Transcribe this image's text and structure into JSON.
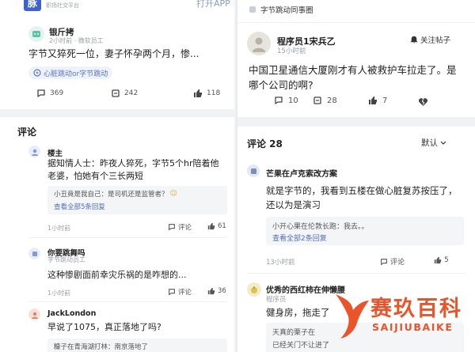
{
  "left": {
    "header": {
      "logo_text": "脉",
      "subtitle": "职场社交平台",
      "open_app": "打开APP"
    },
    "post": {
      "author": "银斤拷",
      "time": "2小时前 · 微软员工",
      "content": "字节又猝死一位，妻子怀孕两个月，惨...",
      "tag": "心脏跳动or字节跳动",
      "stats": {
        "comments": "369",
        "shares": "242",
        "likes": "118"
      }
    },
    "comments_title": "评论",
    "comments": [
      {
        "author": "楼主",
        "content": "据知情人士：昨夜人猝死，字节5个hr陪着他老婆，怕她有个三长两短",
        "quote_line": "小丑竟是我自己：是司机还是监管者？",
        "view_all": "查看全部5条回复",
        "time": "1小时前",
        "comment_label": "评论",
        "likes": "61"
      },
      {
        "author": "你要跳舞吗",
        "role": "字节跳动员工",
        "content": "这种惨剧面前幸灾乐祸的是咋想的...",
        "time": "1小时前",
        "comment_label": "评论",
        "likes": "36"
      },
      {
        "author": "JackLondon",
        "content": "早说了1075，真正落地了吗?",
        "quote_line": "糠子在青海湖打林：南京落地了"
      }
    ]
  },
  "right": {
    "top_tag": "字节跳动同事圈",
    "post": {
      "author": "程序员1宋兵乙",
      "time": "15小时前",
      "follow": "关注帖子",
      "content": "中国卫星通信大厦刚才有人被救护车拉走了。是哪个公司的啊?",
      "stats": {
        "comments": "10",
        "shares": "28",
        "likes": "7"
      }
    },
    "comments_title": "评论 28",
    "sort_label": "默认",
    "comments": [
      {
        "author": "芒果在卢克索改方案",
        "content": "就是字节的，我看到五楼在做心脏复苏按压了，还以为是演习",
        "quote_line": "小开心果在伦敦长跑：我去。。",
        "view_all": "查看全部2条回复",
        "time": "13小时前",
        "comment_label": "评论",
        "likes": "5"
      },
      {
        "author": "优秀的西红柿在伸懒腰",
        "role": "程序员",
        "content": "健身房，拖走了",
        "quote_line1": "天真的栗子在",
        "quote_line2": "已经关门不让进了"
      }
    ]
  },
  "watermark": {
    "title": "赛玖百科",
    "subtitle": "SAIJIUBAIKE"
  },
  "colors": {
    "accent": "#4d6fbf",
    "watermark": "#e9542b"
  }
}
